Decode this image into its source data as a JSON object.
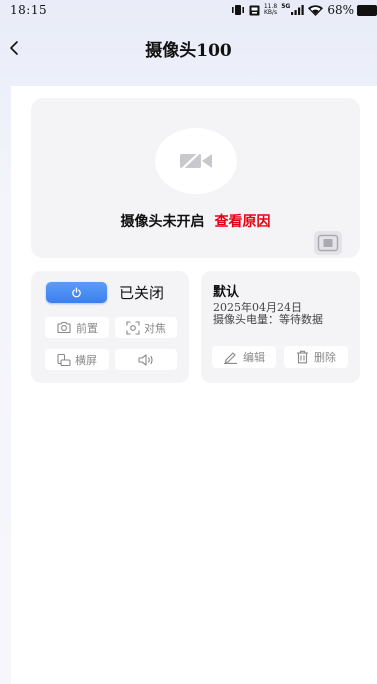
{
  "status_bar": {
    "time": "18:15",
    "net_speed_value": "11.8",
    "net_speed_unit": "KB/s",
    "network_type": "5G",
    "battery_percent": "68%",
    "icons": [
      "vibrate-icon",
      "screen-record-icon",
      "signal-icon",
      "wifi-icon",
      "battery-icon"
    ]
  },
  "header": {
    "title": "摄像头100",
    "back_icon": "chevron-left-icon"
  },
  "video": {
    "status_text": "摄像头未开启",
    "reason_link": "查看原因",
    "placeholder_icon": "camera-off-icon",
    "fullscreen_icon": "fullscreen-icon"
  },
  "controls": {
    "power_icon": "power-icon",
    "power_status": "已关闭",
    "front_label": "前置",
    "focus_label": "对焦",
    "landscape_label": "横屏",
    "volume_icon": "volume-icon"
  },
  "info": {
    "name": "默认",
    "date": "2025年04月24日",
    "battery_text": "摄像头电量：等待数据",
    "edit_label": "编辑",
    "delete_label": "删除"
  },
  "colors": {
    "accent": "#3b7ff0",
    "link": "#e60012",
    "card_bg": "#f4f4f6"
  }
}
